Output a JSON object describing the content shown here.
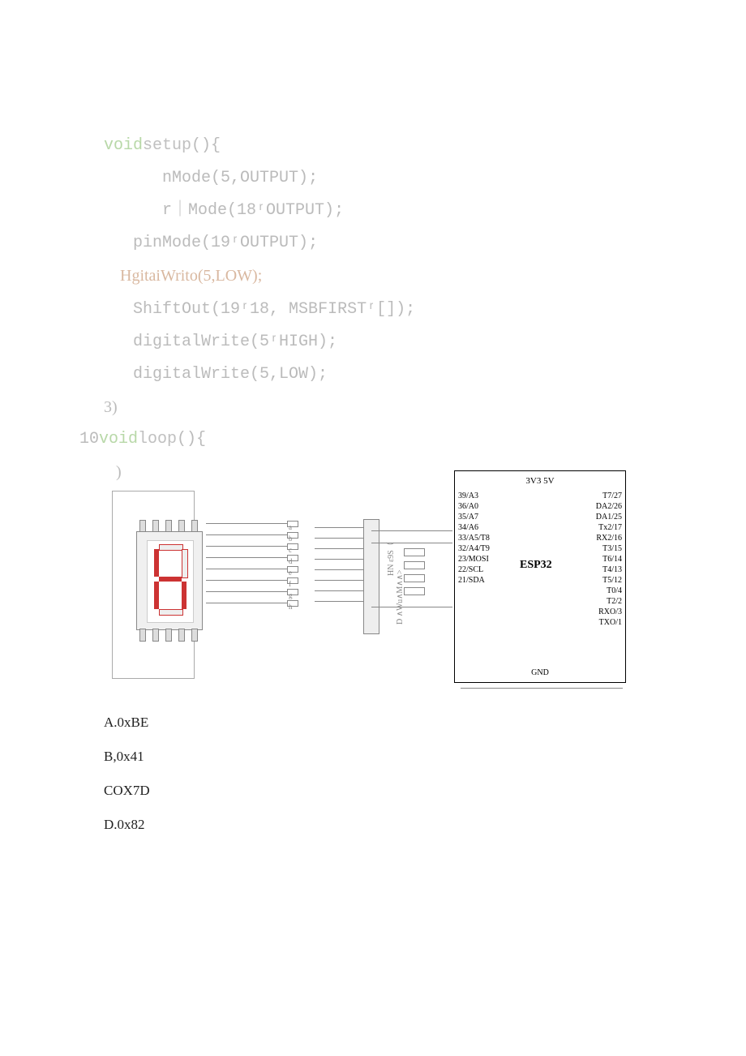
{
  "code": {
    "l1a": "void",
    "l1b": "setup",
    "l1c": "(){",
    "l2a": "      nMode(",
    "l2b": "5",
    "l2c": ",OUTPUT);",
    "l3a": "      r｜Mode(",
    "l3b": "18",
    "l3c": "ʳOUTPUT);",
    "l4a": "   pinMode(",
    "l4b": "19",
    "l4c": "ʳOUTPUT);",
    "l5a": "    HgitaiWrito(",
    "l5b": "5",
    "l5c": ",LOW);",
    "l6a": "   ShiftOut(",
    "l6b": "19",
    "l6c": "ʳ18, MSBFIRSTʳ[]);",
    "l7a": "   digitalWrite(",
    "l7b": "5",
    "l7c": "ʳHIGH);",
    "l8a": "   digitalWrite(",
    "l8b": "5",
    "l8c": ",LOW);",
    "l9": "3)",
    "l10a": "10",
    "l10b": "void",
    "l10c": "loop",
    "l10d": "(){",
    "l11": "   )"
  },
  "seg_labels": [
    "a",
    "b",
    "c",
    "d",
    "e",
    "f",
    "g",
    "h"
  ],
  "shift": {
    "label1": "HN ε9S（",
    "label2": "D ∧Wu∧M∧∧>"
  },
  "esp": {
    "rail": "3V3 5V",
    "left": [
      "39/A3",
      "36/A0",
      "35/A7",
      "34/A6",
      "33/A5/T8",
      "32/A4/T9",
      "",
      "",
      "",
      "23/MOSI",
      "",
      "22/SCL",
      "21/SDA"
    ],
    "right": [
      "T7/27",
      "DA2/26",
      "DA1/25",
      "Tx2/17",
      "RX2/16",
      "T3/15",
      "T6/14",
      "T4/13",
      "T5/12",
      "T0/4",
      "T2/2",
      "RXO/3",
      "TXO/1"
    ],
    "name": "ESP32",
    "gnd": "GND"
  },
  "options": {
    "a": "A.0xBE",
    "b": "B,0x41",
    "c": "COX7D",
    "d": "D.0x82"
  }
}
